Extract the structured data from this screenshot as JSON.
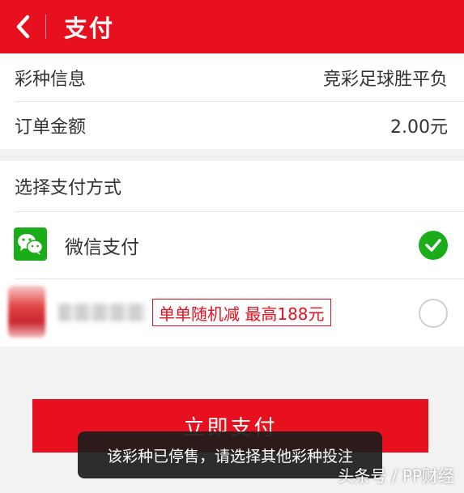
{
  "header": {
    "title": "支付",
    "back_icon": "chevron-left-icon",
    "color": "#e8101f"
  },
  "order_info": {
    "lottery_label": "彩种信息",
    "lottery_value": "竞彩足球胜平负",
    "amount_label": "订单金额",
    "amount_value": "2.00元"
  },
  "payment": {
    "section_title": "选择支付方式",
    "methods": [
      {
        "label": "微信支付",
        "icon": "wechat-icon",
        "selected": true
      },
      {
        "label": "",
        "icon": "bank-logo-icon",
        "promo": "单单随机减  最高188元",
        "selected": false
      }
    ],
    "selected_color": "#1aad19"
  },
  "pay_button": {
    "label": "立即支付"
  },
  "toast": {
    "message": "该彩种已停售，请选择其他彩种投注"
  },
  "watermark": {
    "text": "头条号 / PP财经"
  }
}
